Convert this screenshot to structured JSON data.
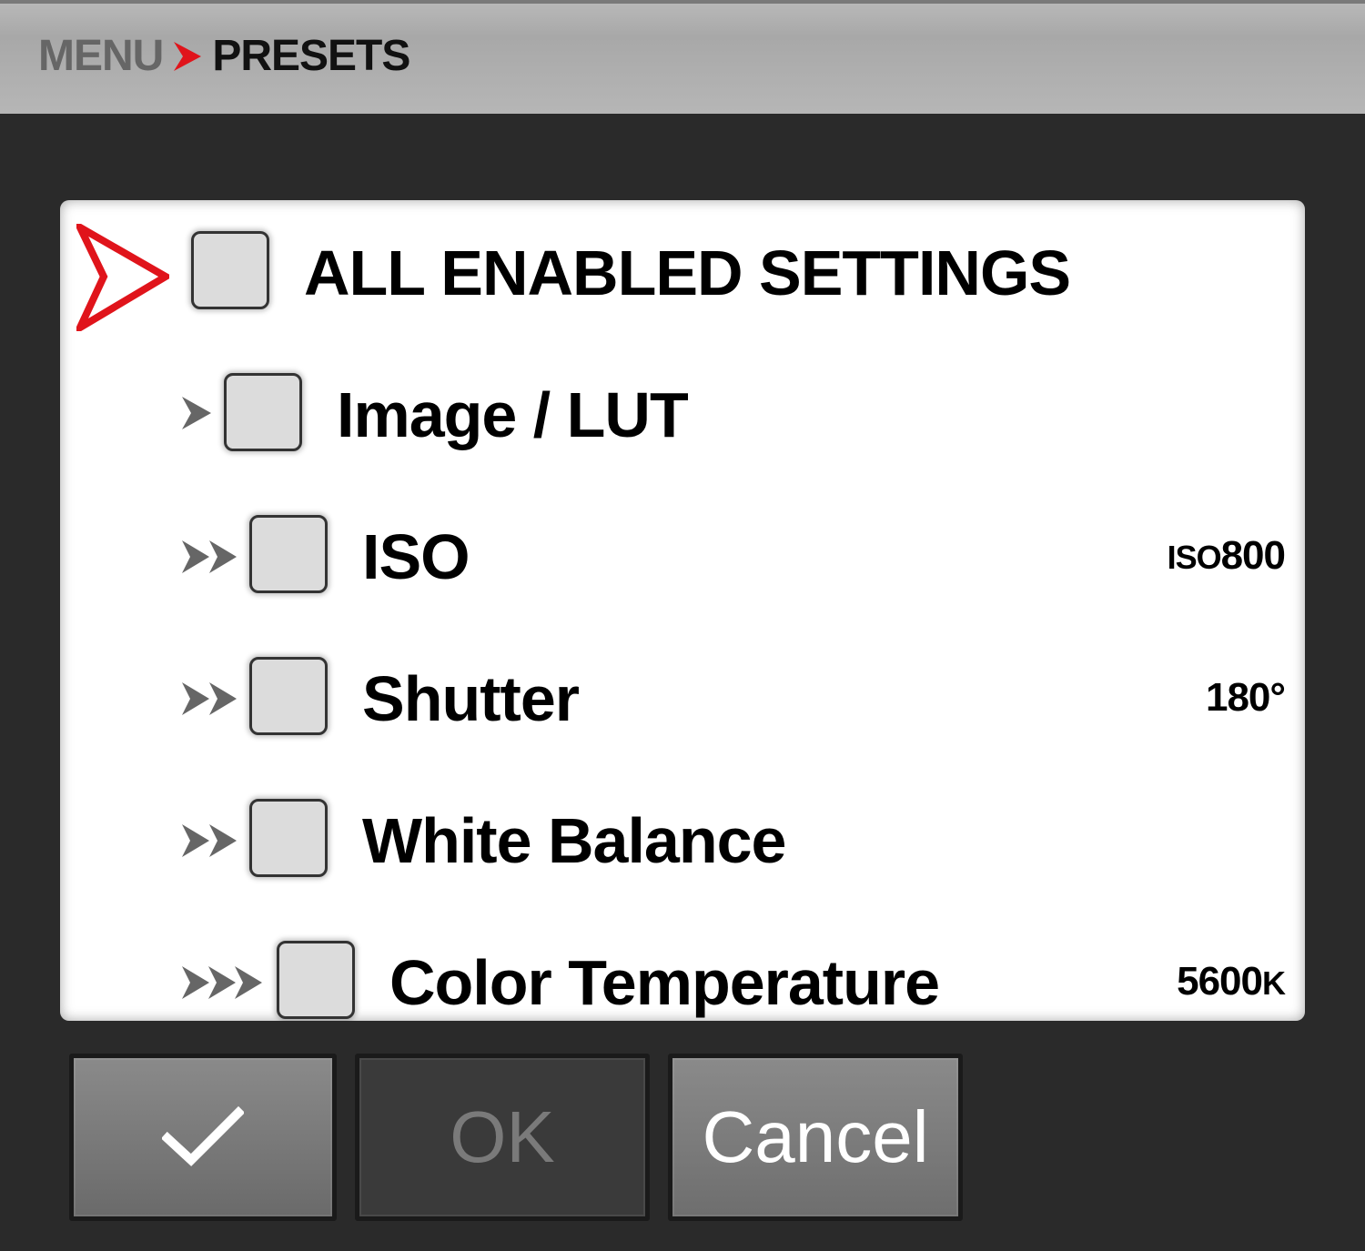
{
  "header": {
    "root_label": "MENU",
    "current_label": "PRESETS",
    "separator_icon": "chevron-right-icon",
    "separator_color": "#e0141b"
  },
  "list": {
    "items": [
      {
        "label": "ALL ENABLED SETTINGS",
        "level": 0,
        "checked": false,
        "value": "",
        "selected": true
      },
      {
        "label": "Image / LUT",
        "level": 1,
        "checked": false,
        "value": ""
      },
      {
        "label": "ISO",
        "level": 2,
        "checked": false,
        "value_prefix": "ISO",
        "value": "800"
      },
      {
        "label": "Shutter",
        "level": 2,
        "checked": false,
        "value": "180°"
      },
      {
        "label": "White Balance",
        "level": 2,
        "checked": false,
        "value": ""
      },
      {
        "label": "Color Temperature",
        "level": 3,
        "checked": false,
        "value": "5600",
        "value_suffix": "K"
      }
    ],
    "selection_icon": "red-outline-arrow-icon",
    "selection_color": "#e0141b"
  },
  "buttons": {
    "confirm_icon": "checkmark-icon",
    "ok_label": "OK",
    "cancel_label": "Cancel"
  }
}
